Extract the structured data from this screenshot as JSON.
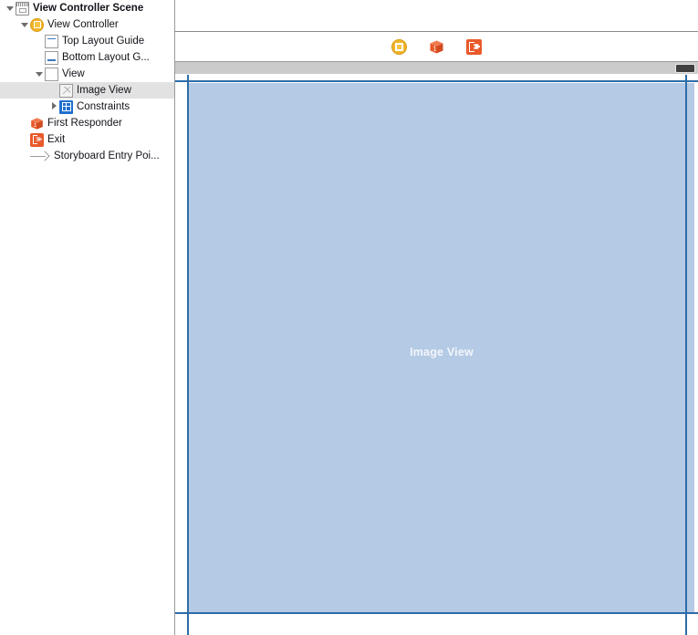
{
  "colors": {
    "selection_blue": "#2d6ca8",
    "view_fill": "#b5cae4",
    "accent_yellow": "#f0b429",
    "accent_orange": "#e8592b",
    "constraints_blue": "#1f6fd0",
    "panel_divider": "#9a9a9a",
    "selected_row": "#e2e2e2",
    "scrollbar_track": "#cbcbcb",
    "scrollbar_thumb": "#3f3f3f"
  },
  "outline": {
    "items": [
      {
        "label": "View Controller Scene",
        "icon": "scene-icon",
        "indent": 0,
        "twisty": "open",
        "bold": true,
        "selected": false
      },
      {
        "label": "View Controller",
        "icon": "view-controller-icon",
        "indent": 1,
        "twisty": "open",
        "bold": false,
        "selected": false
      },
      {
        "label": "Top Layout Guide",
        "icon": "top-layout-guide-icon",
        "indent": 2,
        "twisty": "none",
        "bold": false,
        "selected": false
      },
      {
        "label": "Bottom Layout G...",
        "icon": "bottom-layout-guide-icon",
        "indent": 2,
        "twisty": "none",
        "bold": false,
        "selected": false
      },
      {
        "label": "View",
        "icon": "view-icon",
        "indent": 2,
        "twisty": "open",
        "bold": false,
        "selected": false
      },
      {
        "label": "Image View",
        "icon": "image-view-icon",
        "indent": 3,
        "twisty": "none",
        "bold": false,
        "selected": true
      },
      {
        "label": "Constraints",
        "icon": "constraints-icon",
        "indent": 3,
        "twisty": "closed",
        "bold": false,
        "selected": false
      },
      {
        "label": "First Responder",
        "icon": "first-responder-icon",
        "indent": 1,
        "twisty": "none",
        "bold": false,
        "selected": false
      },
      {
        "label": "Exit",
        "icon": "exit-icon",
        "indent": 1,
        "twisty": "none",
        "bold": false,
        "selected": false
      },
      {
        "label": "Storyboard Entry Poi...",
        "icon": "storyboard-entry-point-icon",
        "indent": 1,
        "twisty": "none",
        "bold": false,
        "selected": false
      }
    ]
  },
  "scene_dock": {
    "items": [
      {
        "name": "view-controller-icon",
        "tooltip": "View Controller"
      },
      {
        "name": "first-responder-icon",
        "tooltip": "First Responder"
      },
      {
        "name": "exit-icon",
        "tooltip": "Exit"
      }
    ]
  },
  "canvas": {
    "selected_view_label": "Image View"
  }
}
